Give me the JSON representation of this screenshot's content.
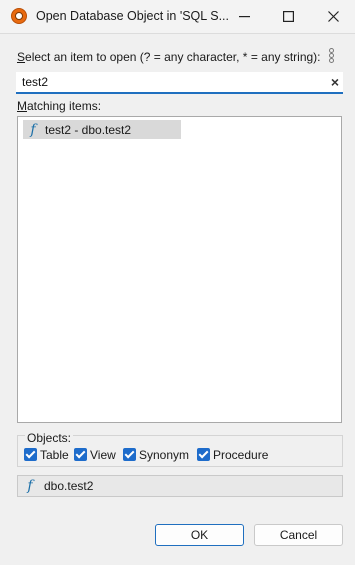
{
  "window": {
    "title": "Open Database Object in 'SQL S...",
    "minimize_glyph": "—",
    "maximize_glyph": "☐",
    "close_glyph": "✕"
  },
  "dialog": {
    "prompt_first": "S",
    "prompt_rest": "elect an item to open (? = any character, * = any string):",
    "search_value": "test2",
    "clear_glyph": "×",
    "matching_first": "M",
    "matching_rest": "atching items:",
    "items": [
      {
        "icon": "function-icon",
        "icon_glyph": "f",
        "label": "test2 - dbo.test2"
      }
    ],
    "objects_label": "Objects:",
    "filters": [
      {
        "label": "Table",
        "checked": true
      },
      {
        "label": "View",
        "checked": true
      },
      {
        "label": "Synonym",
        "checked": true
      },
      {
        "label": "Procedure",
        "checked": true
      }
    ],
    "detail": {
      "icon_glyph": "f",
      "label": "dbo.test2"
    },
    "ok_label": "OK",
    "cancel_label": "Cancel"
  },
  "colors": {
    "accent": "#1f6fbf",
    "checkbox": "#1e6ccb",
    "function_icon": "#1b6fa8",
    "selection": "#d9d9d9"
  }
}
